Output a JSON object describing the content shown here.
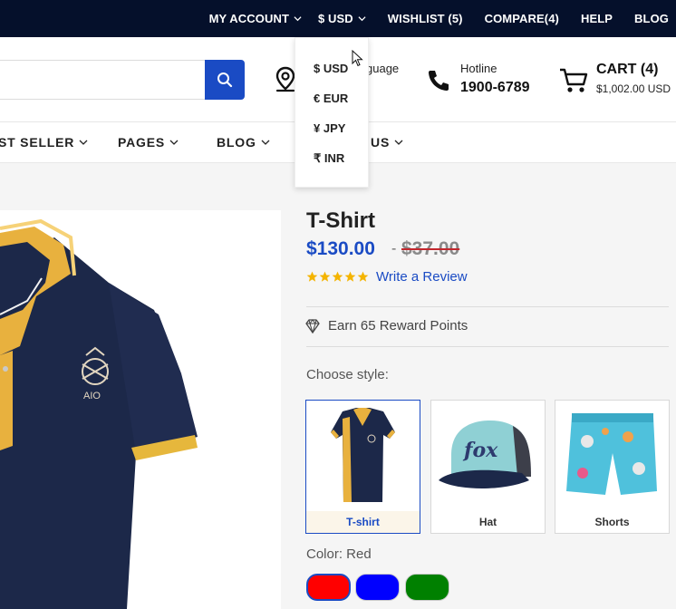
{
  "topbar": {
    "account": "MY ACCOUNT",
    "currency": "$ USD",
    "wishlist": "WISHLIST (5)",
    "compare": "COMPARE(4)",
    "help": "HELP",
    "blog": "BLOG"
  },
  "header": {
    "language_label": "guage",
    "hotline_label": "Hotline",
    "hotline_number": "1900-6789",
    "cart_label": "CART (4)",
    "cart_total": "$1,002.00 USD"
  },
  "nav": {
    "items": [
      "ST SELLER",
      "PAGES",
      "BLOG",
      "T US"
    ]
  },
  "currency_menu": {
    "options": [
      "$ USD",
      "€ EUR",
      "¥ JPY",
      "₹ INR"
    ]
  },
  "product": {
    "title": "T-Shirt",
    "price": "$130.00",
    "price_separator": "-",
    "old_price": "$37.00",
    "rating": 5,
    "review_link": "Write a Review",
    "reward": "Earn 65 Reward Points",
    "choose_style_label": "Choose style:",
    "styles": [
      "T-shirt",
      "Hat",
      "Shorts"
    ],
    "selected_style": "T-shirt",
    "color_label": "Color: Red",
    "colors": [
      "#ff0000",
      "#0000ff",
      "#008000"
    ]
  },
  "theme": {
    "accent": "#1a4bc4",
    "topbar_bg": "#05102b",
    "star": "#f4b400"
  }
}
